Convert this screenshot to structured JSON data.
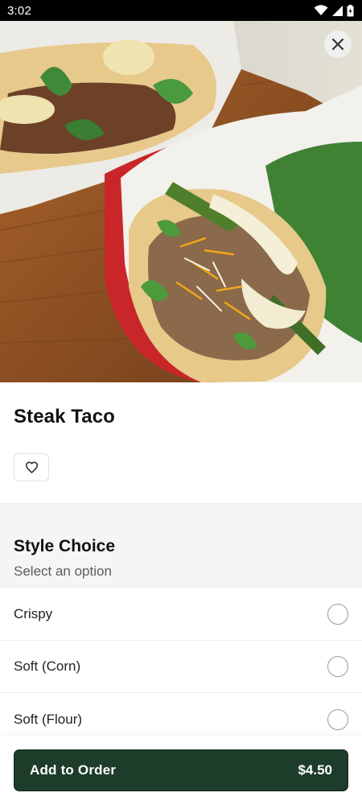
{
  "status_bar": {
    "time": "3:02",
    "icons": [
      "wifi-icon",
      "signal-icon",
      "battery-icon"
    ]
  },
  "hero": {
    "image_alt": "steak-taco-photo",
    "close_icon": "close-icon"
  },
  "item": {
    "title": "Steak Taco",
    "favorite_icon": "heart-icon"
  },
  "options": {
    "title": "Style Choice",
    "subtitle": "Select an option",
    "items": [
      {
        "label": "Crispy",
        "selected": false
      },
      {
        "label": "Soft (Corn)",
        "selected": false
      },
      {
        "label": "Soft (Flour)",
        "selected": false
      }
    ]
  },
  "cart": {
    "add_label": "Add to Order",
    "price": "$4.50"
  },
  "colors": {
    "primary_button": "#1d3d2a",
    "section_background": "#f5f5f7"
  }
}
